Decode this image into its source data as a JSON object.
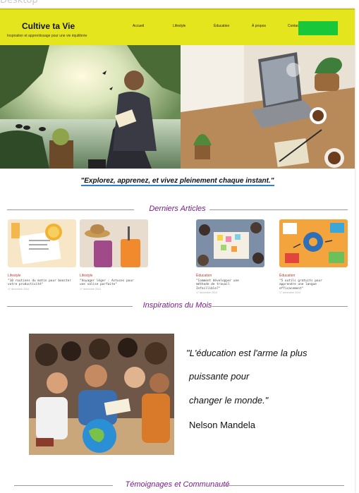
{
  "frame": {
    "label": "Desktop"
  },
  "header": {
    "brand": "Cultive ta Vie",
    "tagline": "Inspiration et apprentissage pour une vie équilibrée",
    "nav": [
      "Accueil",
      "Lifestyle",
      "Éducation",
      "À propos",
      "Contact"
    ],
    "cta_label": "",
    "colors": {
      "header_bg": "#e5e51e",
      "cta_bg": "#19c73a"
    }
  },
  "hero": {
    "left_image": "man-reading-by-lake-illustration",
    "right_image": "laptop-desk-with-coffee-illustration"
  },
  "slogan": "\"Explorez, apprenez, et vivez pleinement chaque instant.\"",
  "sections": {
    "latest": "Derniers Articles",
    "inspirations": "Inspirations du Mois",
    "community": "Témoignages et Communauté"
  },
  "articles": [
    {
      "category": "Lifestyle",
      "text": "\"10 routines du matin pour booster\nvotre productivité\"",
      "date": "17 décembre 2024",
      "image": "morning-routine-notebook"
    },
    {
      "category": "Lifestyle",
      "text": "\"Voyager léger : Astuces pour\nune valise parfaite\"",
      "date": "17 décembre 2024",
      "image": "suitcases-with-hat"
    },
    {
      "category": "Éducation",
      "text": "\"Comment développer une\nméthode de travail\nInfaillible?\"",
      "date": "17 décembre 2024",
      "image": "team-planning-sticky-notes"
    },
    {
      "category": "Éducation",
      "text": "\"5 outils gratuits pour\napprendre une langue\nefficacement\"",
      "date": "17 décembre 2024",
      "image": "learning-tools-illustration"
    }
  ],
  "inspiration": {
    "image": "students-around-globe",
    "quote_lines": [
      "\"L'éducation est l'arme la plus",
      "puissante pour",
      "changer le monde.\""
    ],
    "author": "Nelson Mandela"
  }
}
